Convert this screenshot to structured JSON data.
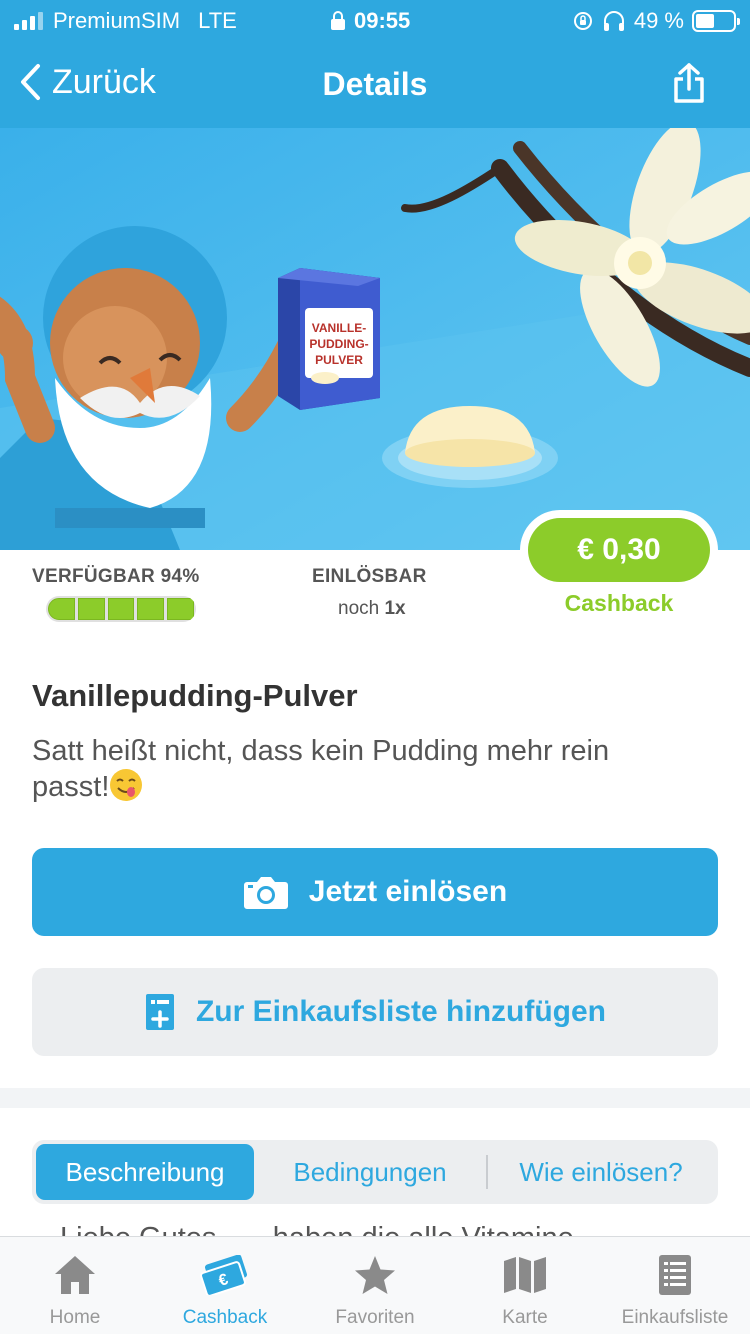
{
  "status_bar": {
    "carrier": "PremiumSIM",
    "network": "LTE",
    "time": "09:55",
    "battery": "49 %",
    "battery_level": 0.49
  },
  "nav": {
    "back_label": "Zurück",
    "title": "Details"
  },
  "hero": {
    "box_text_line1": "VANILLE-",
    "box_text_line2": "PUDDING-",
    "box_text_line3": "PULVER"
  },
  "stats": {
    "available_label": "VERFÜGBAR",
    "available_value": "94%",
    "available_fraction": 0.94,
    "redeemable_label": "EINLÖSBAR",
    "redeemable_prefix": "noch",
    "redeemable_count": "1x",
    "cashback_amount": "€ 0,30",
    "cashback_label": "Cashback"
  },
  "product": {
    "title": "Vanillepudding-Pulver",
    "description": "Satt heißt nicht, dass kein Pudding mehr rein passt!"
  },
  "actions": {
    "redeem_label": "Jetzt einlösen",
    "add_list_label": "Zur Einkaufsliste hinzufügen"
  },
  "tabs": {
    "items": [
      "Beschreibung",
      "Bedingungen",
      "Wie einlösen?"
    ],
    "active": "Beschreibung"
  },
  "peek_text": "Liebe Gutes... – haben die alle Vitamine",
  "tabbar": {
    "items": [
      {
        "label": "Home",
        "icon": "home-icon"
      },
      {
        "label": "Cashback",
        "icon": "cashback-icon"
      },
      {
        "label": "Favoriten",
        "icon": "star-icon"
      },
      {
        "label": "Karte",
        "icon": "map-icon"
      },
      {
        "label": "Einkaufsliste",
        "icon": "list-icon"
      }
    ],
    "active": "Cashback"
  },
  "colors": {
    "brand_blue": "#2ea8df",
    "cashback_green": "#8ccc2a",
    "text_dark": "#333333"
  }
}
